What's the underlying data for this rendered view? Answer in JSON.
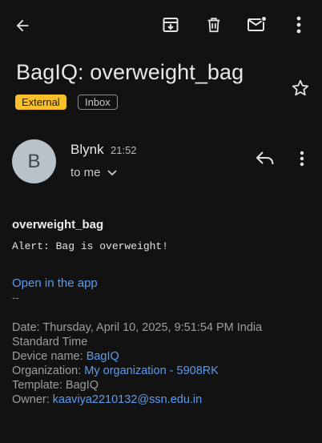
{
  "toolbar": {
    "back_icon": "arrow-left-icon",
    "archive_icon": "archive-icon",
    "delete_icon": "trash-icon",
    "mark_unread_icon": "mark-unread-icon",
    "more_icon": "more-vert-icon"
  },
  "email": {
    "subject": "BagIQ: overweight_bag",
    "labels": [
      "External",
      "Inbox"
    ],
    "starred": false,
    "sender": {
      "avatar_initial": "B",
      "name": "Blynk",
      "time": "21:52",
      "recipient": "to me"
    },
    "body": {
      "title": "overweight_bag",
      "alert": "Alert: Bag is overweight!",
      "link_text": "Open in the app",
      "separator": "--",
      "date_line1": "Date: Thursday, April 10, 2025, 9:51:54 PM India",
      "date_line2": "Standard Time",
      "device_label": "Device name: ",
      "device_value": "BagIQ",
      "org_label": "Organization: ",
      "org_value": "My organization - 5908RK",
      "template_label": "Template: BagIQ",
      "owner_label": "Owner: ",
      "owner_value": "kaaviya2210132@ssn.edu.in"
    }
  },
  "colors": {
    "background": "#121212",
    "external_chip": "#f7c02b",
    "link": "#5b9cf0"
  }
}
